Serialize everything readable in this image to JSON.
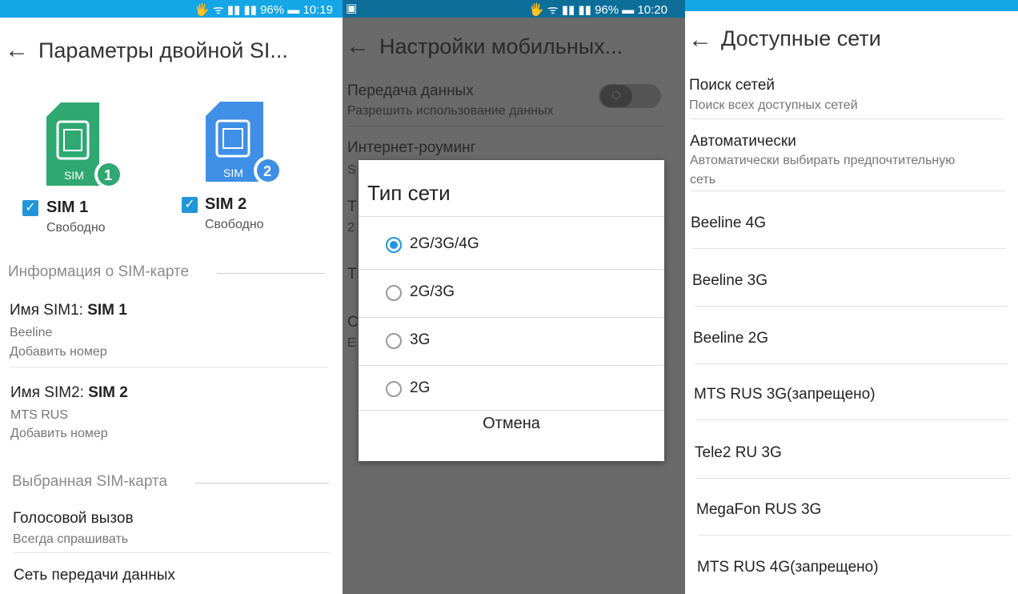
{
  "status1": {
    "icons": "🖐 ᯤ ▮▮ ▮▮",
    "battery": "96%",
    "time": "10:19"
  },
  "status2": {
    "icons": "🖐 ᯤ ▮▮ ▮▮",
    "battery": "96%",
    "time": "10:20"
  },
  "panel1": {
    "title": "Параметры двойной SI...",
    "sim1": {
      "chip": "SIM",
      "num": "1",
      "label": "SIM 1",
      "status": "Свободно",
      "color": "#2fa872"
    },
    "sim2": {
      "chip": "SIM",
      "num": "2",
      "label": "SIM 2",
      "status": "Свободно",
      "color": "#3f8fe6"
    },
    "section1": "Информация о SIM-карте",
    "item1": {
      "label": "Имя SIM1: ",
      "bold": "SIM 1",
      "sub1": "Beeline",
      "sub2": "Добавить номер"
    },
    "item2": {
      "label": "Имя SIM2: ",
      "bold": "SIM 2",
      "sub1": "MTS RUS",
      "sub2": "Добавить номер"
    },
    "section2": "Выбранная SIM-карта",
    "voice": {
      "label": "Голосовой вызов",
      "sub": "Всегда спрашивать"
    },
    "data": {
      "label": "Сеть передачи данных"
    }
  },
  "panel2": {
    "title": "Настройки мобильных...",
    "data_transfer": {
      "label": "Передача данных",
      "sub": "Разрешить использование данных",
      "toggle": "O"
    },
    "roaming": {
      "label": "Интернет-роуминг"
    },
    "dialog": {
      "title": "Тип сети",
      "options": [
        "2G/3G/4G",
        "2G/3G",
        "3G",
        "2G"
      ],
      "selected": 0,
      "cancel": "Отмена"
    }
  },
  "panel3": {
    "title": "Доступные сети",
    "search": {
      "label": "Поиск сетей",
      "sub": "Поиск всех доступных сетей"
    },
    "auto": {
      "label": "Автоматически",
      "sub1": "Автоматически выбирать предпочтительную",
      "sub2": "сеть"
    },
    "networks": [
      "Beeline 4G",
      "Beeline 3G",
      "Beeline 2G",
      "MTS RUS 3G(запрещено)",
      "Tele2 RU 3G",
      "MegaFon RUS 3G",
      "MTS RUS 4G(запрещено)"
    ]
  },
  "colors": {
    "accent": "#2196d9",
    "statusbar": "#14a6e6",
    "sim1": "#2fa872",
    "sim2": "#3f8fe6"
  }
}
